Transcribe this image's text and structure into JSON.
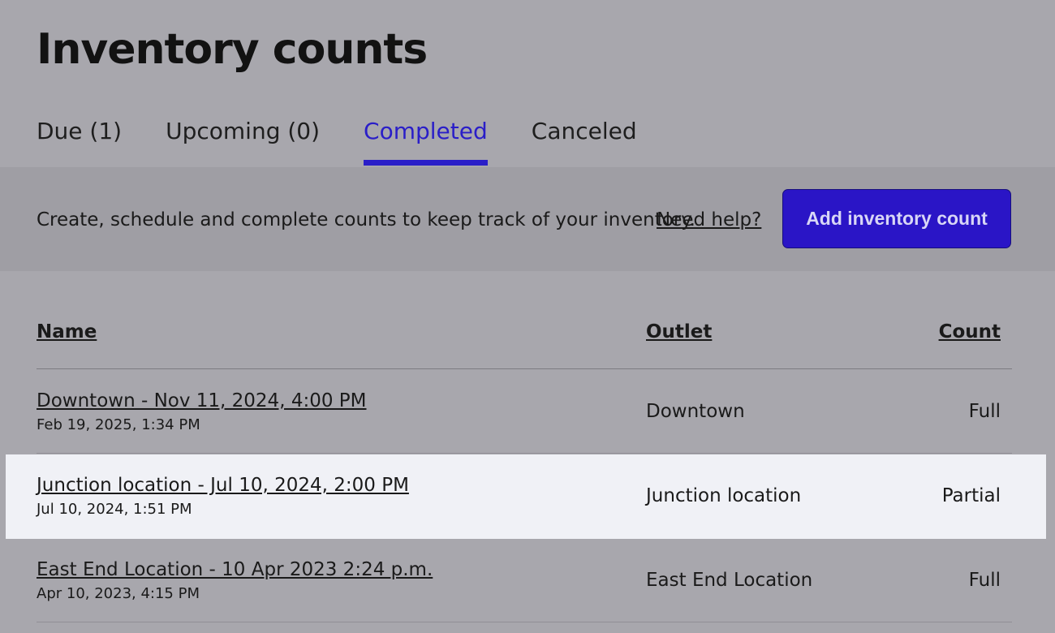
{
  "page": {
    "title": "Inventory counts"
  },
  "tabs": [
    {
      "label": "Due (1)",
      "active": false
    },
    {
      "label": "Upcoming (0)",
      "active": false
    },
    {
      "label": "Completed",
      "active": true
    },
    {
      "label": "Canceled",
      "active": false
    }
  ],
  "info": {
    "text": "Create, schedule and complete counts to keep track of your inventory.",
    "help_link": "Need help?",
    "add_button": "Add inventory count"
  },
  "table": {
    "columns": {
      "name": "Name",
      "outlet": "Outlet",
      "count": "Count"
    },
    "rows": [
      {
        "name": "Downtown - Nov 11, 2024, 4:00 PM",
        "date": "Feb 19, 2025, 1:34 PM",
        "outlet": "Downtown",
        "count": "Full",
        "highlighted": false
      },
      {
        "name": "Junction location - Jul 10, 2024, 2:00 PM",
        "date": "Jul 10, 2024, 1:51 PM",
        "outlet": "Junction location",
        "count": "Partial",
        "highlighted": true
      },
      {
        "name": "East End Location - 10 Apr 2023 2:24 p.m.",
        "date": "Apr 10, 2023, 4:15 PM",
        "outlet": "East End Location",
        "count": "Full",
        "highlighted": false
      }
    ]
  },
  "colors": {
    "accent": "#2a1ec8",
    "button_bg": "#2a15c6",
    "page_bg": "#a8a7ad",
    "highlight_row_bg": "#f0f1f6"
  }
}
